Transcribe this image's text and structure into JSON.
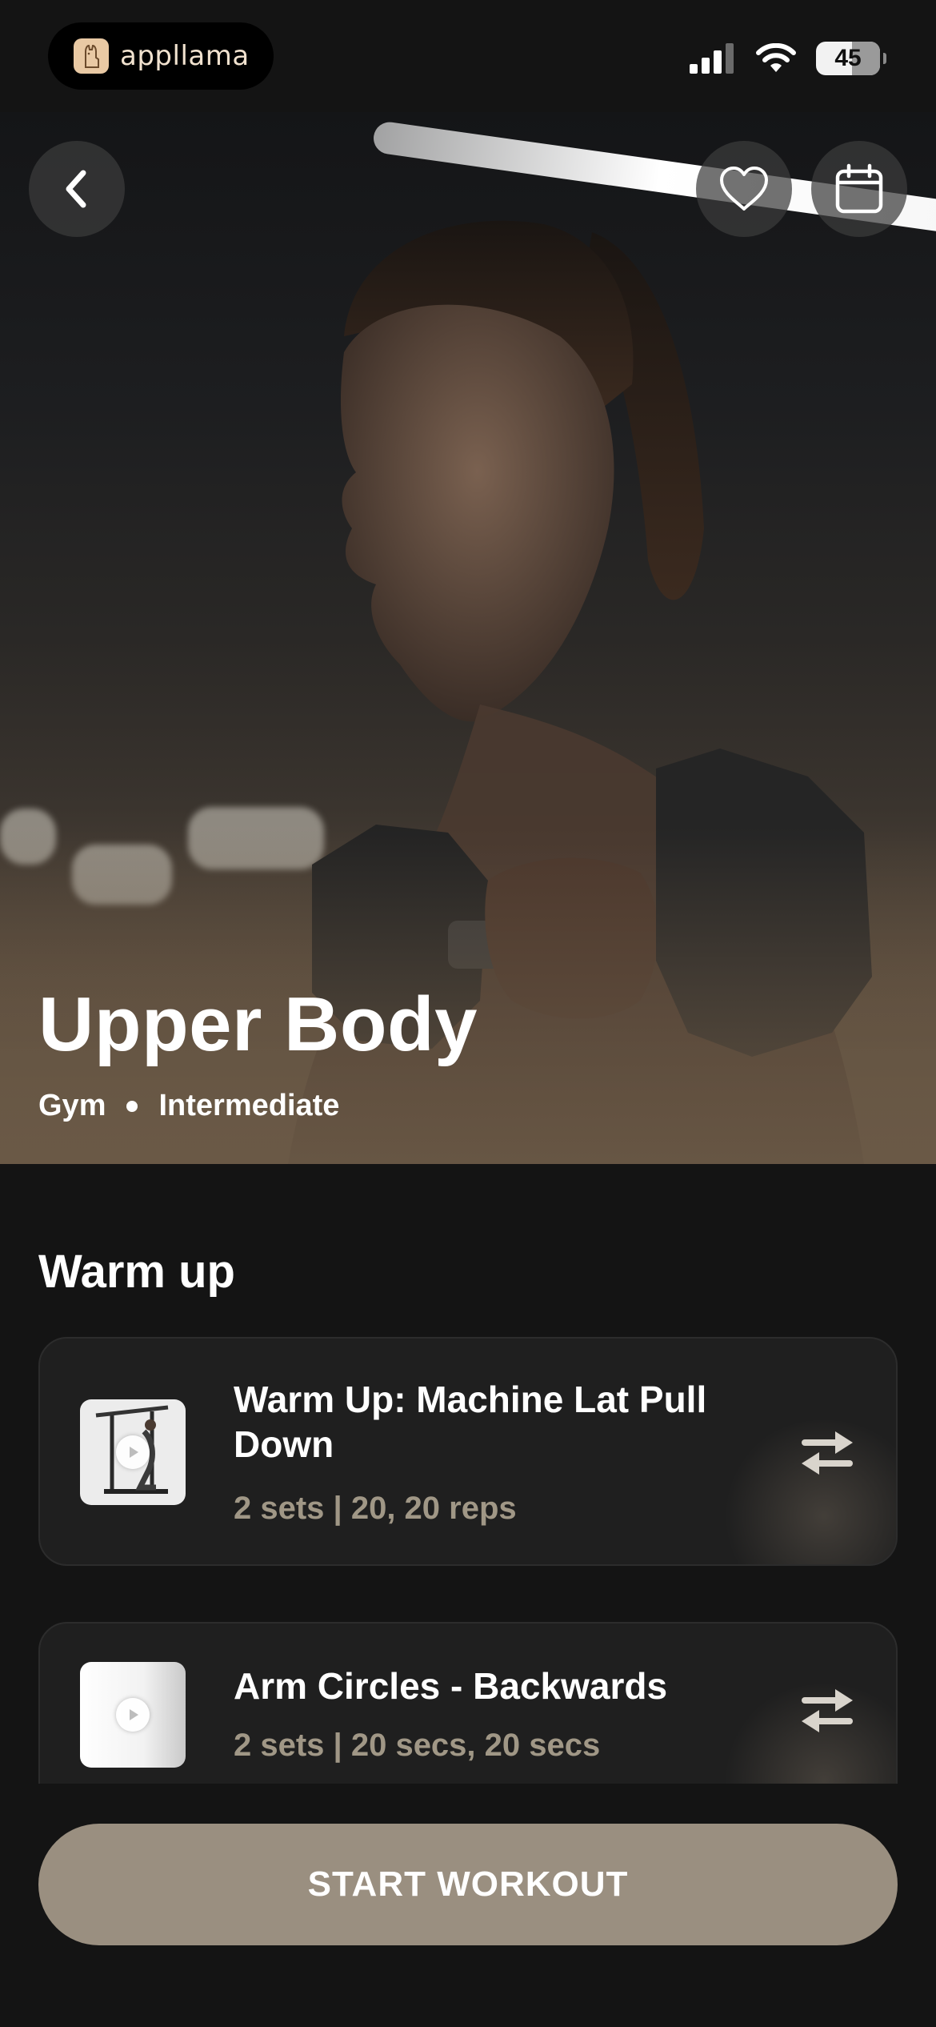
{
  "status_bar": {
    "brand_name": "appllama",
    "battery_level": "45",
    "icons": [
      "signal-icon",
      "wifi-icon",
      "battery-icon"
    ]
  },
  "hero": {
    "title": "Upper Body",
    "location": "Gym",
    "level": "Intermediate",
    "icons": [
      "back-chevron-icon",
      "heart-icon",
      "calendar-icon"
    ]
  },
  "section": {
    "title": "Warm up"
  },
  "exercises": [
    {
      "name": "Warm Up: Machine Lat Pull Down",
      "detail": "2 sets | 20, 20 reps"
    },
    {
      "name": "Arm Circles - Backwards",
      "detail": "2 sets | 20 secs, 20 secs"
    }
  ],
  "cta": {
    "label": "START WORKOUT"
  },
  "colors": {
    "background": "#141414",
    "card": "#1f1f1f",
    "accent": "#9a8f80",
    "muted_text": "#a09786"
  }
}
